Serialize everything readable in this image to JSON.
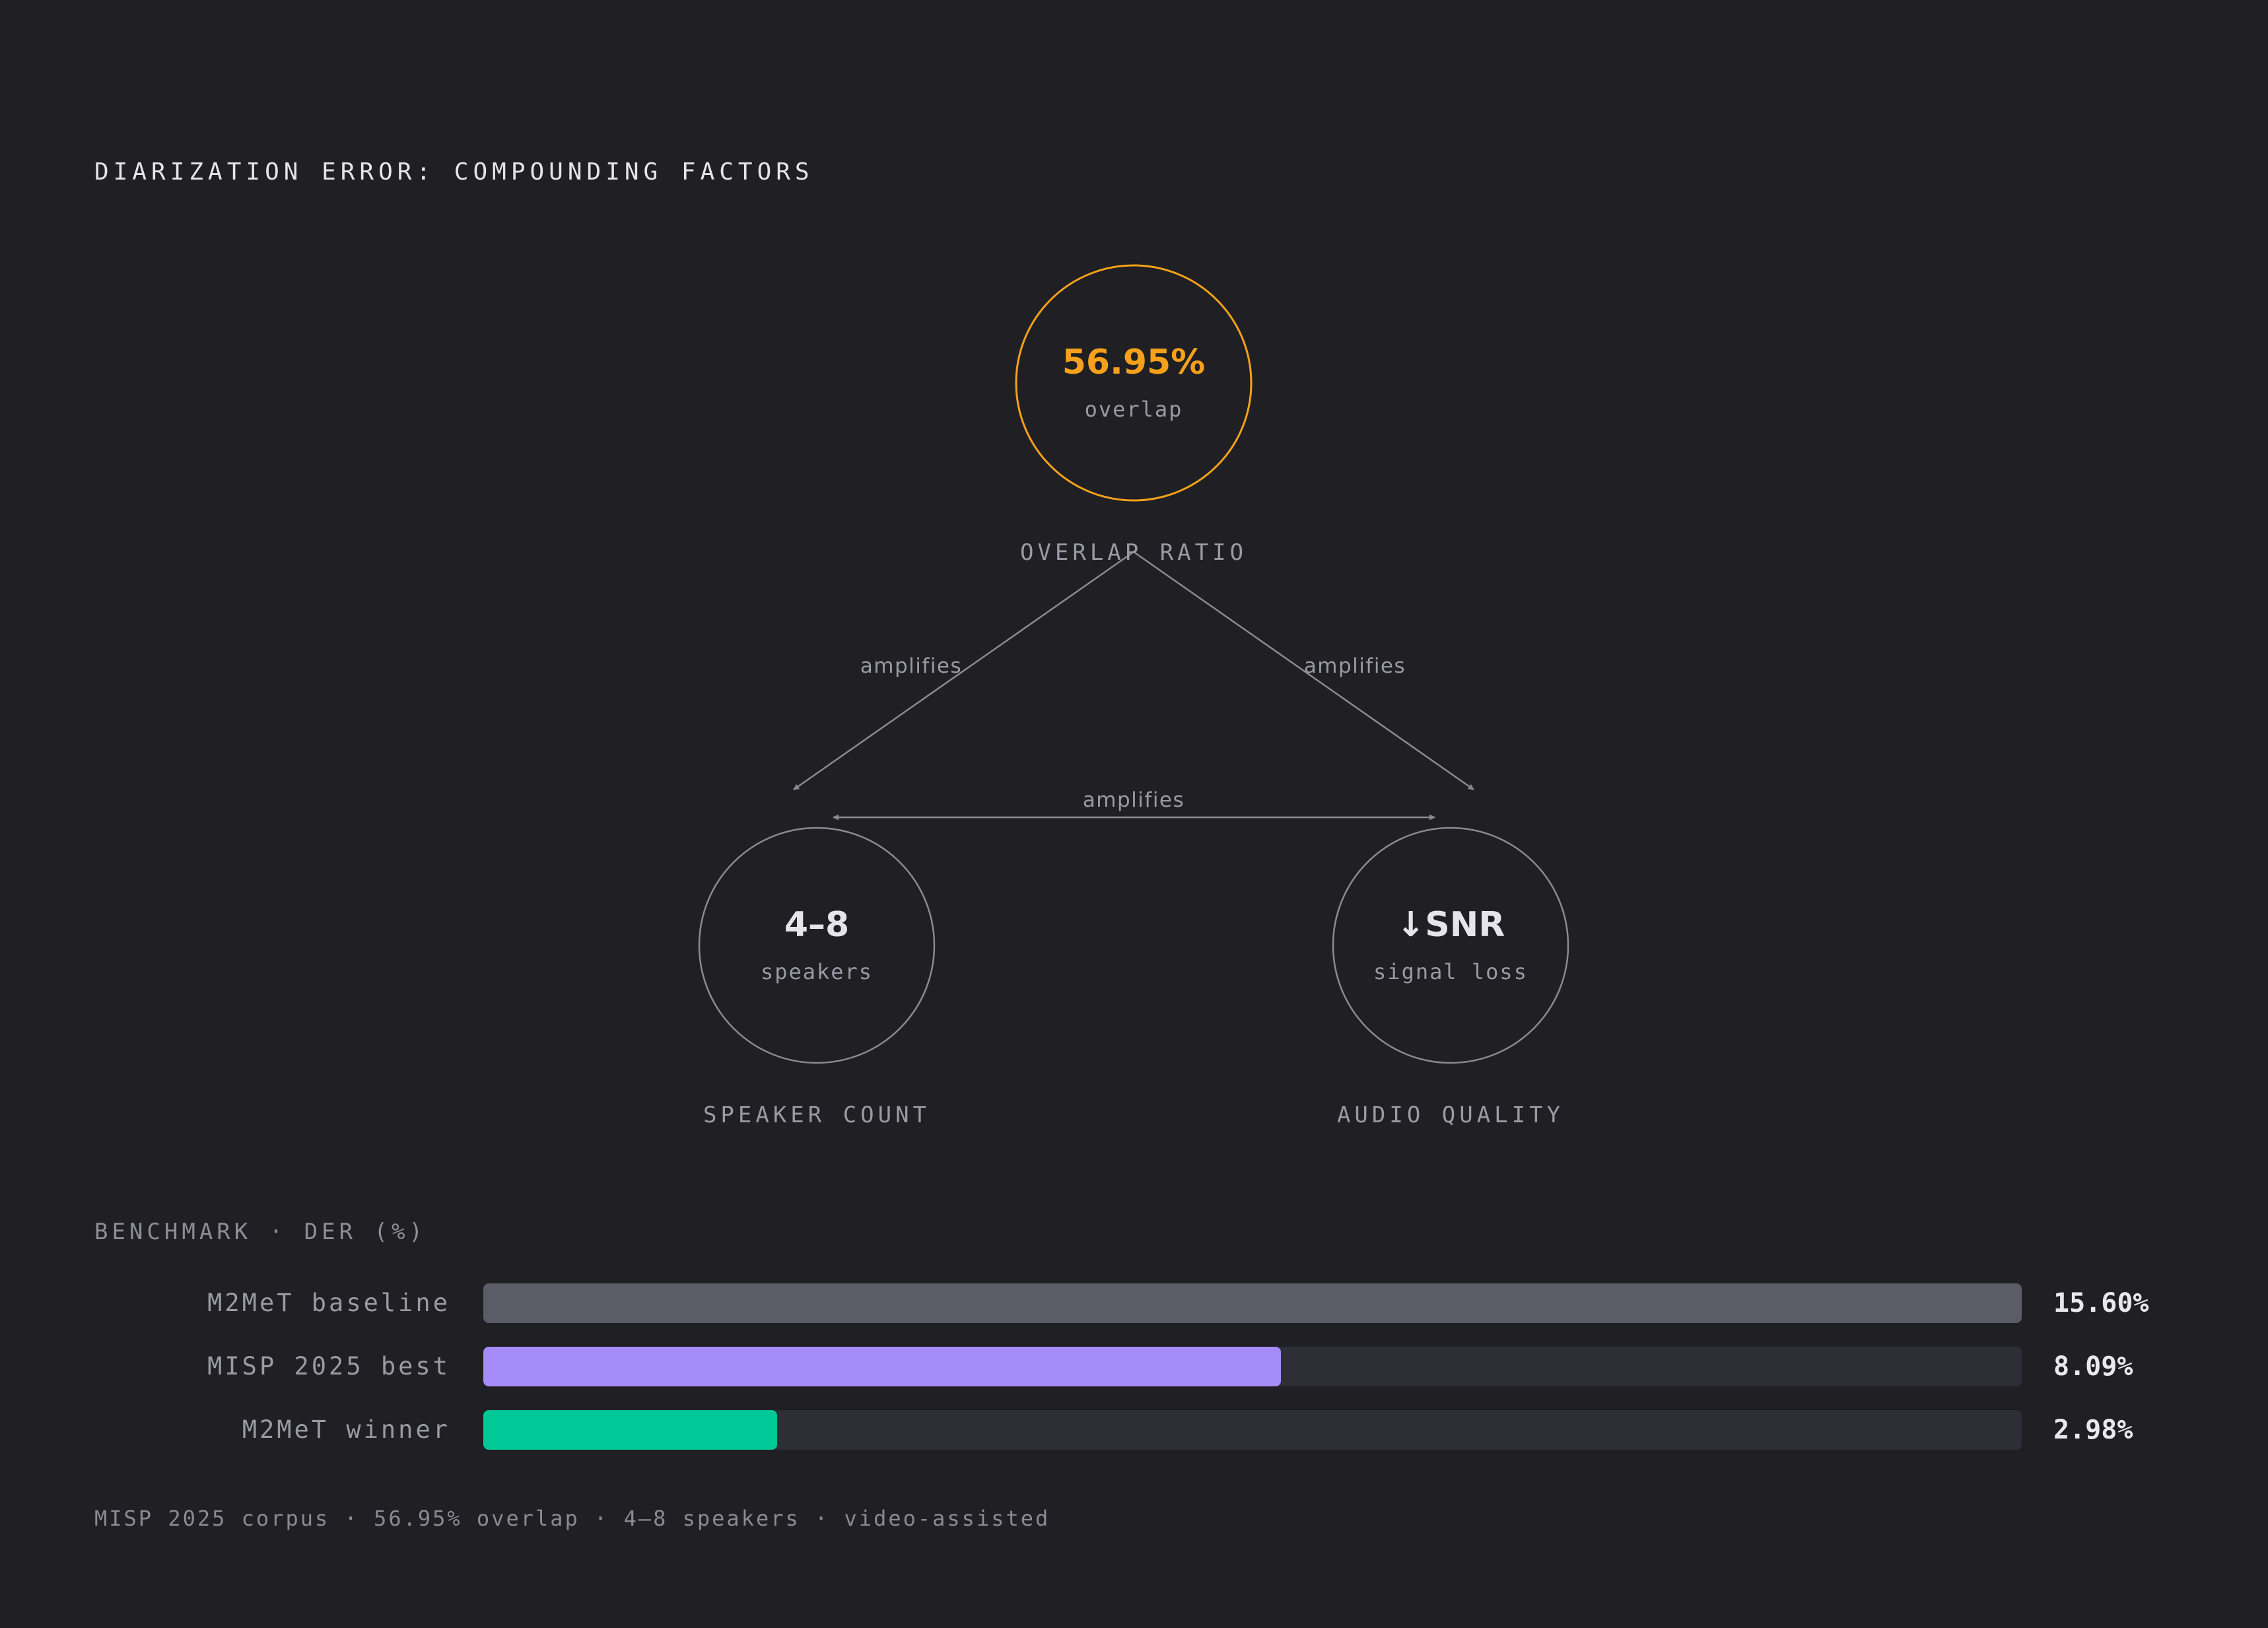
{
  "title": "DIARIZATION ERROR: COMPOUNDING FACTORS",
  "colors": {
    "background": "#1f1f24",
    "accent_orange": "#f5a11a",
    "neutral_line": "#8a8a92",
    "bar_gray": "#5c5c66",
    "bar_purple": "#a68bfa",
    "bar_green": "#00c896",
    "track": "#2e2e37"
  },
  "diagram": {
    "nodes": {
      "overlap": {
        "value": "56.95%",
        "sub": "overlap",
        "label": "OVERLAP RATIO"
      },
      "speakers": {
        "value": "4–8",
        "sub": "speakers",
        "label": "SPEAKER COUNT"
      },
      "audio": {
        "value": "↓SNR",
        "sub": "signal loss",
        "label": "AUDIO QUALITY"
      }
    },
    "edges": [
      {
        "from": "overlap",
        "to": "speakers",
        "label": "amplifies"
      },
      {
        "from": "overlap",
        "to": "audio",
        "label": "amplifies"
      },
      {
        "from": "speakers",
        "to": "audio",
        "label": "amplifies"
      }
    ]
  },
  "benchmark": {
    "title": "BENCHMARK · DER (%)",
    "max": 15.6,
    "rows": [
      {
        "name": "M2MeT baseline",
        "value": 15.6,
        "display": "15.60%",
        "color": "#5c5c66"
      },
      {
        "name": "MISP 2025 best",
        "value": 8.09,
        "display": "8.09%",
        "color": "#a68bfa"
      },
      {
        "name": "M2MeT winner",
        "value": 2.98,
        "display": "2.98%",
        "color": "#00c896"
      }
    ]
  },
  "footer": "MISP 2025 corpus · 56.95% overlap · 4–8 speakers · video-assisted"
}
